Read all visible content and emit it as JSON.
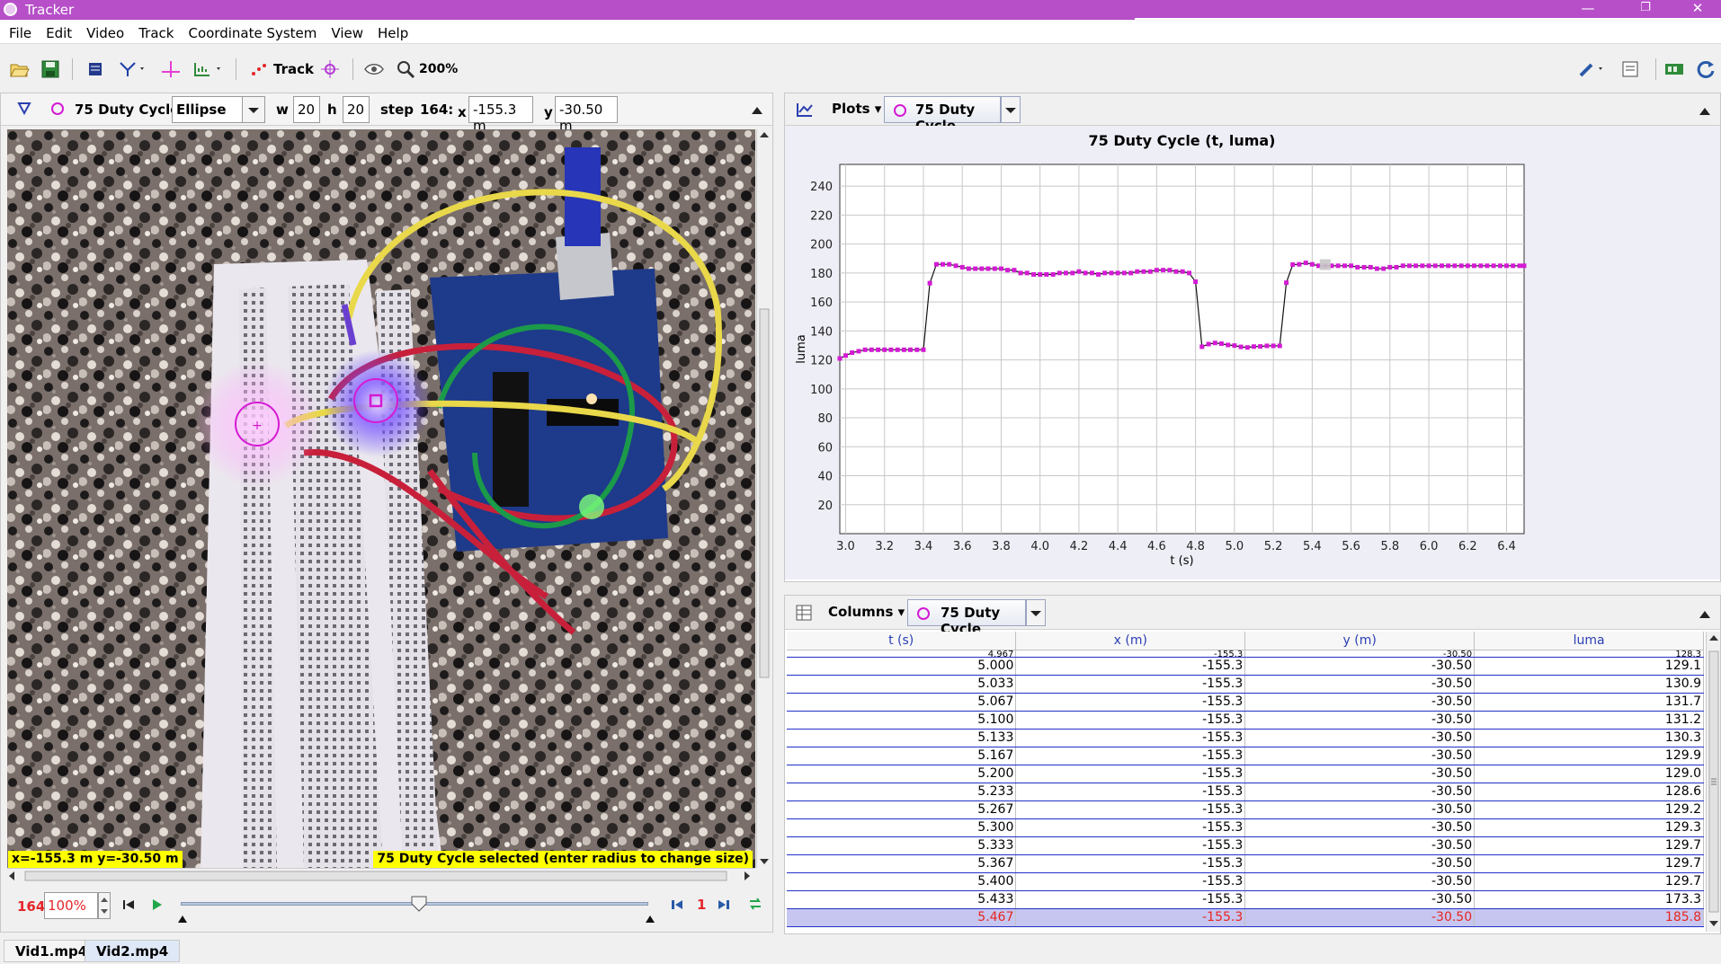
{
  "window": {
    "title": "Tracker",
    "minimize": "—",
    "restore": "❐",
    "close": "✕"
  },
  "menu": [
    "File",
    "Edit",
    "Video",
    "Track",
    "Coordinate System",
    "View",
    "Help"
  ],
  "toolbar": {
    "track_label": "Track",
    "zoom_label": "200%"
  },
  "trackbar": {
    "track_name": "75 Duty Cycle",
    "shape": "Ellipse",
    "w_label": "w",
    "w_value": "20",
    "h_label": "h",
    "h_value": "20",
    "step_label": "step",
    "step_value": "164:",
    "x_label": "x",
    "x_value": "-155.3 m",
    "y_label": "y",
    "y_value": "-30.50 m"
  },
  "video": {
    "readout": "x=-155.3 m  y=-30.50 m",
    "status": "75 Duty Cycle selected (enter radius to change size)"
  },
  "player": {
    "frame": "164",
    "rate": "100%",
    "step_size": "1",
    "slider_position": 0.51
  },
  "plot": {
    "view_button": "Plots",
    "track_button": "75 Duty Cycle",
    "accent": "#d41ad4"
  },
  "chart_data": {
    "type": "line",
    "title": "75 Duty Cycle (t, luma)",
    "xlabel": "t (s)",
    "ylabel": "luma",
    "xlim": [
      2.97,
      6.49
    ],
    "ylim": [
      0,
      255
    ],
    "xticks": [
      "3.0",
      "3.2",
      "3.4",
      "3.6",
      "3.8",
      "4.0",
      "4.2",
      "4.4",
      "4.6",
      "4.8",
      "5.0",
      "5.2",
      "5.4",
      "5.6",
      "5.8",
      "6.0",
      "6.2",
      "6.4"
    ],
    "yticks": [
      "20",
      "40",
      "60",
      "80",
      "100",
      "120",
      "140",
      "160",
      "180",
      "200",
      "220",
      "240"
    ],
    "grid": true,
    "series": [
      {
        "color": "#d41ad4",
        "x": [
          2.967,
          3.0,
          3.033,
          3.067,
          3.1,
          3.133,
          3.167,
          3.2,
          3.233,
          3.267,
          3.3,
          3.333,
          3.367,
          3.4,
          3.433,
          3.467,
          3.5,
          3.533,
          3.567,
          3.6,
          3.633,
          3.667,
          3.7,
          3.733,
          3.767,
          3.8,
          3.833,
          3.867,
          3.9,
          3.933,
          3.967,
          4.0,
          4.033,
          4.067,
          4.1,
          4.133,
          4.167,
          4.2,
          4.233,
          4.267,
          4.3,
          4.333,
          4.367,
          4.4,
          4.433,
          4.467,
          4.5,
          4.533,
          4.567,
          4.6,
          4.633,
          4.667,
          4.7,
          4.733,
          4.767,
          4.8,
          4.833,
          4.867,
          4.9,
          4.933,
          4.967,
          5.0,
          5.033,
          5.067,
          5.1,
          5.133,
          5.167,
          5.2,
          5.233,
          5.267,
          5.3,
          5.333,
          5.367,
          5.4,
          5.433,
          5.467,
          5.5,
          5.533,
          5.567,
          5.6,
          5.633,
          5.667,
          5.7,
          5.733,
          5.767,
          5.8,
          5.833,
          5.867,
          5.9,
          5.933,
          5.967,
          6.0,
          6.033,
          6.067,
          6.1,
          6.133,
          6.167,
          6.2,
          6.233,
          6.267,
          6.3,
          6.333,
          6.367,
          6.4,
          6.433,
          6.467,
          6.5
        ],
        "y": [
          121,
          123,
          125,
          126,
          127,
          127,
          127,
          127,
          127,
          127,
          127,
          127,
          127,
          127,
          173,
          186,
          186,
          186,
          185,
          184,
          183,
          183,
          183,
          183,
          183,
          183,
          182,
          182,
          180,
          180,
          179,
          179,
          179,
          179,
          180,
          180,
          180,
          181,
          180,
          180,
          179,
          180,
          180,
          180,
          180,
          180,
          181,
          181,
          181,
          182,
          182,
          182,
          181,
          181,
          180,
          174,
          129.1,
          130.9,
          131.7,
          131.2,
          130.3,
          129.9,
          129.0,
          128.6,
          129.2,
          129.3,
          129.7,
          129.7,
          129.7,
          173.3,
          185.8,
          186,
          187,
          186,
          185,
          185,
          185,
          185,
          185,
          185,
          184,
          184,
          184,
          183,
          183,
          184,
          184,
          185,
          185,
          185,
          185,
          185,
          185,
          185,
          185,
          185,
          185,
          185,
          185,
          185,
          185,
          185,
          185,
          185,
          185,
          185,
          185
        ]
      }
    ]
  },
  "table": {
    "view_button": "Columns",
    "track_button": "75 Duty Cycle",
    "columns": [
      "t (s)",
      "x (m)",
      "y (m)",
      "luma"
    ],
    "partial_row": [
      "4.967",
      "-155.3",
      "-30.50",
      "128.3"
    ],
    "rows": [
      [
        "5.000",
        "-155.3",
        "-30.50",
        "129.1"
      ],
      [
        "5.033",
        "-155.3",
        "-30.50",
        "130.9"
      ],
      [
        "5.067",
        "-155.3",
        "-30.50",
        "131.7"
      ],
      [
        "5.100",
        "-155.3",
        "-30.50",
        "131.2"
      ],
      [
        "5.133",
        "-155.3",
        "-30.50",
        "130.3"
      ],
      [
        "5.167",
        "-155.3",
        "-30.50",
        "129.9"
      ],
      [
        "5.200",
        "-155.3",
        "-30.50",
        "129.0"
      ],
      [
        "5.233",
        "-155.3",
        "-30.50",
        "128.6"
      ],
      [
        "5.267",
        "-155.3",
        "-30.50",
        "129.2"
      ],
      [
        "5.300",
        "-155.3",
        "-30.50",
        "129.3"
      ],
      [
        "5.333",
        "-155.3",
        "-30.50",
        "129.7"
      ],
      [
        "5.367",
        "-155.3",
        "-30.50",
        "129.7"
      ],
      [
        "5.400",
        "-155.3",
        "-30.50",
        "129.7"
      ],
      [
        "5.433",
        "-155.3",
        "-30.50",
        "173.3"
      ],
      [
        "5.467",
        "-155.3",
        "-30.50",
        "185.8"
      ]
    ],
    "selected_row": 14
  },
  "tabs": [
    "Vid1.mp4",
    "Vid2.mp4"
  ]
}
